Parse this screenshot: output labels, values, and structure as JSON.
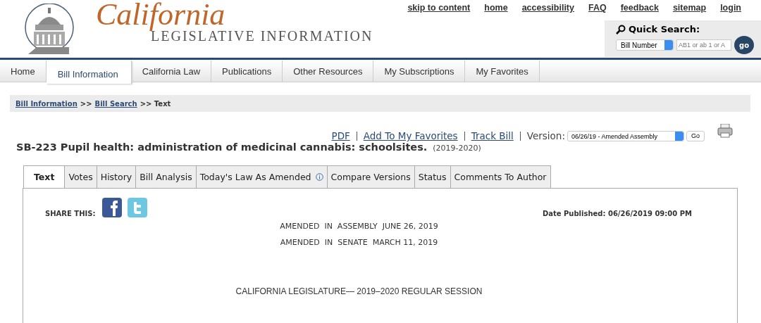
{
  "logo": {
    "script": "California",
    "subtitle": "LEGISLATIVE INFORMATION"
  },
  "top_links": [
    "skip to content",
    "home",
    "accessibility",
    "FAQ",
    "feedback",
    "sitemap",
    "login"
  ],
  "quick_search": {
    "title": "Quick Search:",
    "type": "Bill Number",
    "placeholder": "AB1 or ab 1 or A",
    "button": "go"
  },
  "nav": [
    {
      "label": "Home",
      "selected": false
    },
    {
      "label": "Bill Information",
      "selected": true
    },
    {
      "label": "California Law",
      "selected": false
    },
    {
      "label": "Publications",
      "selected": false
    },
    {
      "label": "Other Resources",
      "selected": false
    },
    {
      "label": "My Subscriptions",
      "selected": false
    },
    {
      "label": "My Favorites",
      "selected": false
    }
  ],
  "breadcrumb": [
    {
      "label": "Bill Information",
      "kind": "link"
    },
    {
      "label": ">>",
      "kind": "sep"
    },
    {
      "label": "Bill Search",
      "kind": "link"
    },
    {
      "label": ">> Text",
      "kind": "text"
    }
  ],
  "actions": [
    "PDF",
    "Add To My Favorites",
    "Track Bill"
  ],
  "version": {
    "label": "Version:",
    "value": "06/26/19 - Amended Assembly",
    "button": "Go"
  },
  "bill": {
    "title": "SB-223 Pupil health: administration of medicinal cannabis: schoolsites.",
    "session": "(2019-2020)"
  },
  "tabs": [
    {
      "label": "Text",
      "selected": true,
      "info": false
    },
    {
      "label": "Votes",
      "selected": false,
      "info": false
    },
    {
      "label": "History",
      "selected": false,
      "info": false
    },
    {
      "label": "Bill Analysis",
      "selected": false,
      "info": false
    },
    {
      "label": "Today's Law As Amended",
      "selected": false,
      "info": true
    },
    {
      "label": "Compare Versions",
      "selected": false,
      "info": false
    },
    {
      "label": "Status",
      "selected": false,
      "info": false
    },
    {
      "label": "Comments To Author",
      "selected": false,
      "info": false
    }
  ],
  "share_label": "SHARE THIS:",
  "date_published": "Date Published: 06/26/2019 09:00 PM",
  "amendments": [
    "AMENDED  IN  ASSEMBLY  JUNE 26, 2019",
    "AMENDED  IN  SENATE  MARCH 11, 2019"
  ],
  "session_heading": "CALIFORNIA LEGISLATURE— 2019–2020 REGULAR SESSION"
}
